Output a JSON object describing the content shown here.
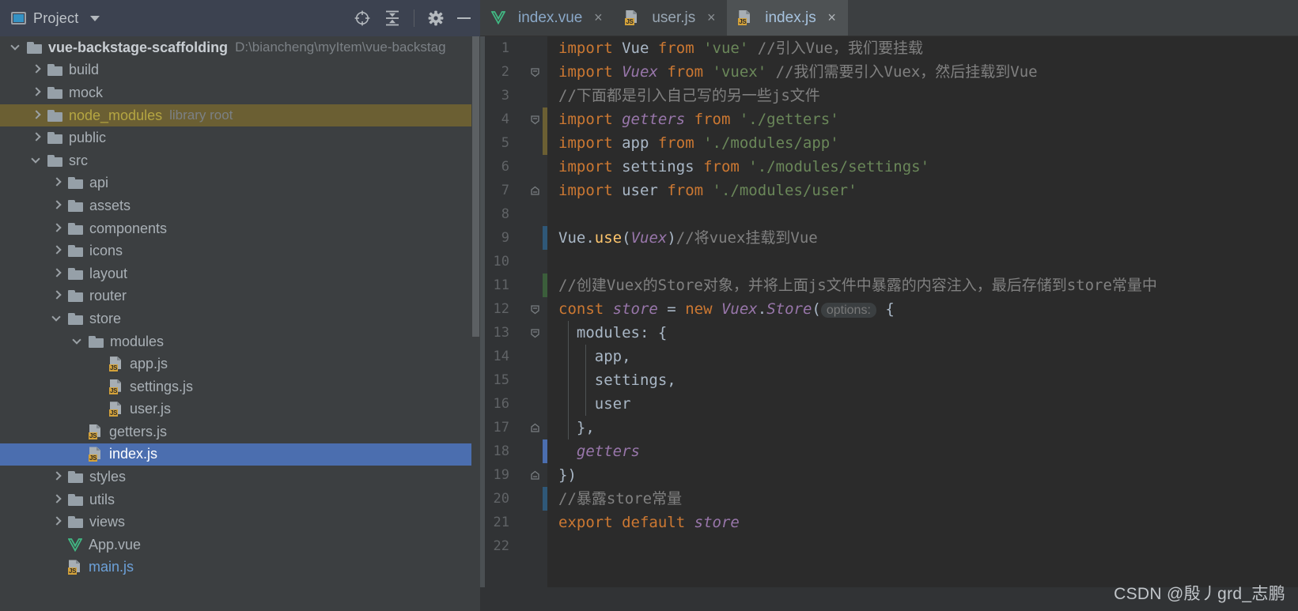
{
  "sidebar": {
    "title": "Project",
    "icons": [
      "project-window-icon",
      "chevron-down-icon",
      "locate-target-icon",
      "collapse-all-icon",
      "settings-gear-icon",
      "minimize-icon"
    ],
    "scrollbar": "vertical-scrollbar",
    "tree": [
      {
        "label": "vue-backstage-scaffolding",
        "sub": "D:\\biancheng\\myItem\\vue-backstag",
        "depth": 0,
        "type": "folder",
        "state": "open",
        "style": "root"
      },
      {
        "label": "build",
        "sub": "",
        "depth": 1,
        "type": "folder",
        "state": "closed",
        "style": "normal"
      },
      {
        "label": "mock",
        "sub": "",
        "depth": 1,
        "type": "folder",
        "state": "closed",
        "style": "normal"
      },
      {
        "label": "node_modules",
        "sub": "library root",
        "depth": 1,
        "type": "folder",
        "state": "closed",
        "style": "yellowed",
        "row": "highlight"
      },
      {
        "label": "public",
        "sub": "",
        "depth": 1,
        "type": "folder",
        "state": "closed",
        "style": "normal"
      },
      {
        "label": "src",
        "sub": "",
        "depth": 1,
        "type": "folder",
        "state": "open",
        "style": "normal"
      },
      {
        "label": "api",
        "sub": "",
        "depth": 2,
        "type": "folder",
        "state": "closed",
        "style": "normal"
      },
      {
        "label": "assets",
        "sub": "",
        "depth": 2,
        "type": "folder",
        "state": "closed",
        "style": "normal"
      },
      {
        "label": "components",
        "sub": "",
        "depth": 2,
        "type": "folder",
        "state": "closed",
        "style": "normal"
      },
      {
        "label": "icons",
        "sub": "",
        "depth": 2,
        "type": "folder",
        "state": "closed",
        "style": "normal"
      },
      {
        "label": "layout",
        "sub": "",
        "depth": 2,
        "type": "folder",
        "state": "closed",
        "style": "normal"
      },
      {
        "label": "router",
        "sub": "",
        "depth": 2,
        "type": "folder",
        "state": "closed",
        "style": "normal"
      },
      {
        "label": "store",
        "sub": "",
        "depth": 2,
        "type": "folder",
        "state": "open",
        "style": "normal"
      },
      {
        "label": "modules",
        "sub": "",
        "depth": 3,
        "type": "folder",
        "state": "open",
        "style": "normal"
      },
      {
        "label": "app.js",
        "sub": "",
        "depth": 4,
        "type": "js",
        "state": "leaf",
        "style": "normal"
      },
      {
        "label": "settings.js",
        "sub": "",
        "depth": 4,
        "type": "js",
        "state": "leaf",
        "style": "normal"
      },
      {
        "label": "user.js",
        "sub": "",
        "depth": 4,
        "type": "js",
        "state": "leaf",
        "style": "normal"
      },
      {
        "label": "getters.js",
        "sub": "",
        "depth": 3,
        "type": "js",
        "state": "leaf",
        "style": "normal"
      },
      {
        "label": "index.js",
        "sub": "",
        "depth": 3,
        "type": "js",
        "state": "leaf",
        "style": "normal",
        "row": "selected"
      },
      {
        "label": "styles",
        "sub": "",
        "depth": 2,
        "type": "folder",
        "state": "closed",
        "style": "normal"
      },
      {
        "label": "utils",
        "sub": "",
        "depth": 2,
        "type": "folder",
        "state": "closed",
        "style": "normal"
      },
      {
        "label": "views",
        "sub": "",
        "depth": 2,
        "type": "folder",
        "state": "closed",
        "style": "normal"
      },
      {
        "label": "App.vue",
        "sub": "",
        "depth": 2,
        "type": "vue",
        "state": "leaf",
        "style": "normal"
      },
      {
        "label": "main.js",
        "sub": "",
        "depth": 2,
        "type": "js",
        "state": "leaf",
        "style": "bluefile"
      }
    ]
  },
  "editor": {
    "tabs": [
      {
        "label": "index.vue",
        "icon": "vue-file-icon",
        "active": false,
        "close": "×"
      },
      {
        "label": "user.js",
        "icon": "js-file-icon",
        "active": false,
        "close": "×"
      },
      {
        "label": "index.js",
        "icon": "js-file-icon",
        "active": true,
        "close": "×"
      }
    ],
    "line_numbers": [
      "1",
      "2",
      "3",
      "4",
      "5",
      "6",
      "7",
      "8",
      "9",
      "10",
      "11",
      "12",
      "13",
      "14",
      "15",
      "16",
      "17",
      "18",
      "19",
      "20",
      "21",
      "22"
    ],
    "code_lines": [
      {
        "n": 1,
        "tokens": [
          {
            "t": "import",
            "c": "kw"
          },
          {
            "t": " ",
            "c": "punct"
          },
          {
            "t": "Vue",
            "c": "cls"
          },
          {
            "t": " ",
            "c": "punct"
          },
          {
            "t": "from",
            "c": "kw"
          },
          {
            "t": " ",
            "c": "punct"
          },
          {
            "t": "'vue'",
            "c": "str"
          },
          {
            "t": " ",
            "c": "punct"
          },
          {
            "t": "//引入Vue，我们要挂载",
            "c": "cmt"
          }
        ]
      },
      {
        "n": 2,
        "tokens": [
          {
            "t": "import",
            "c": "kw"
          },
          {
            "t": " ",
            "c": "punct"
          },
          {
            "t": "Vuex",
            "c": "glob"
          },
          {
            "t": " ",
            "c": "punct"
          },
          {
            "t": "from",
            "c": "kw"
          },
          {
            "t": " ",
            "c": "punct"
          },
          {
            "t": "'vuex'",
            "c": "str"
          },
          {
            "t": " ",
            "c": "punct"
          },
          {
            "t": "//我们需要引入Vuex，然后挂载到Vue",
            "c": "cmt"
          }
        ]
      },
      {
        "n": 3,
        "tokens": [
          {
            "t": "//下面都是引入自己写的另一些js文件",
            "c": "cmt"
          }
        ]
      },
      {
        "n": 4,
        "tokens": [
          {
            "t": "import",
            "c": "kw"
          },
          {
            "t": " ",
            "c": "punct"
          },
          {
            "t": "getters",
            "c": "glob"
          },
          {
            "t": " ",
            "c": "punct"
          },
          {
            "t": "from",
            "c": "kw"
          },
          {
            "t": " ",
            "c": "punct"
          },
          {
            "t": "'./getters'",
            "c": "str"
          }
        ]
      },
      {
        "n": 5,
        "tokens": [
          {
            "t": "import",
            "c": "kw"
          },
          {
            "t": " ",
            "c": "punct"
          },
          {
            "t": "app",
            "c": "cls"
          },
          {
            "t": " ",
            "c": "punct"
          },
          {
            "t": "from",
            "c": "kw"
          },
          {
            "t": " ",
            "c": "punct"
          },
          {
            "t": "'./modules/app'",
            "c": "str"
          }
        ]
      },
      {
        "n": 6,
        "tokens": [
          {
            "t": "import",
            "c": "kw"
          },
          {
            "t": " ",
            "c": "punct"
          },
          {
            "t": "settings",
            "c": "cls"
          },
          {
            "t": " ",
            "c": "punct"
          },
          {
            "t": "from",
            "c": "kw"
          },
          {
            "t": " ",
            "c": "punct"
          },
          {
            "t": "'./modules/settings'",
            "c": "str"
          }
        ]
      },
      {
        "n": 7,
        "tokens": [
          {
            "t": "import",
            "c": "kw"
          },
          {
            "t": " ",
            "c": "punct"
          },
          {
            "t": "user",
            "c": "cls"
          },
          {
            "t": " ",
            "c": "punct"
          },
          {
            "t": "from",
            "c": "kw"
          },
          {
            "t": " ",
            "c": "punct"
          },
          {
            "t": "'./modules/user'",
            "c": "str"
          }
        ]
      },
      {
        "n": 8,
        "tokens": []
      },
      {
        "n": 9,
        "tokens": [
          {
            "t": "Vue",
            "c": "cls"
          },
          {
            "t": ".",
            "c": "punct"
          },
          {
            "t": "use",
            "c": "fn"
          },
          {
            "t": "(",
            "c": "punct"
          },
          {
            "t": "Vuex",
            "c": "glob"
          },
          {
            "t": ")",
            "c": "punct"
          },
          {
            "t": "//将vuex挂载到Vue",
            "c": "cmt"
          }
        ]
      },
      {
        "n": 10,
        "tokens": []
      },
      {
        "n": 11,
        "tokens": [
          {
            "t": "//创建Vuex的Store对象，并将上面js文件中暴露的内容注入，最后存储到store常量中",
            "c": "cmt"
          }
        ]
      },
      {
        "n": 12,
        "tokens": [
          {
            "t": "const",
            "c": "kw"
          },
          {
            "t": " ",
            "c": "punct"
          },
          {
            "t": "store",
            "c": "glob"
          },
          {
            "t": " = ",
            "c": "punct"
          },
          {
            "t": "new",
            "c": "kw"
          },
          {
            "t": " ",
            "c": "punct"
          },
          {
            "t": "Vuex",
            "c": "glob"
          },
          {
            "t": ".",
            "c": "punct"
          },
          {
            "t": "Store",
            "c": "glob"
          },
          {
            "t": "(",
            "c": "punct"
          },
          {
            "t": "options:",
            "c": "hint"
          },
          {
            "t": " {",
            "c": "punct"
          }
        ]
      },
      {
        "n": 13,
        "tokens": [
          {
            "t": "  modules: {",
            "c": "punct"
          }
        ]
      },
      {
        "n": 14,
        "tokens": [
          {
            "t": "    app,",
            "c": "punct"
          }
        ]
      },
      {
        "n": 15,
        "tokens": [
          {
            "t": "    settings,",
            "c": "punct"
          }
        ]
      },
      {
        "n": 16,
        "tokens": [
          {
            "t": "    user",
            "c": "punct"
          }
        ]
      },
      {
        "n": 17,
        "tokens": [
          {
            "t": "  },",
            "c": "punct"
          }
        ]
      },
      {
        "n": 18,
        "tokens": [
          {
            "t": "  ",
            "c": "punct"
          },
          {
            "t": "getters",
            "c": "glob"
          }
        ]
      },
      {
        "n": 19,
        "tokens": [
          {
            "t": "})",
            "c": "punct"
          }
        ]
      },
      {
        "n": 20,
        "tokens": [
          {
            "t": "//暴露store常量",
            "c": "cmt"
          }
        ]
      },
      {
        "n": 21,
        "tokens": [
          {
            "t": "export",
            "c": "kw"
          },
          {
            "t": " ",
            "c": "punct"
          },
          {
            "t": "default",
            "c": "kw"
          },
          {
            "t": " ",
            "c": "punct"
          },
          {
            "t": "store",
            "c": "glob"
          }
        ]
      },
      {
        "n": 22,
        "tokens": []
      }
    ],
    "gutter_markers": [
      {
        "line": 4,
        "color": "#6b5f33"
      },
      {
        "line": 5,
        "color": "#6b5f33"
      },
      {
        "line": 9,
        "color": "#2f5878"
      },
      {
        "line": 11,
        "color": "#3b5e3b"
      },
      {
        "line": 18,
        "color": "#4b6eaf"
      },
      {
        "line": 20,
        "color": "#2f5878"
      }
    ],
    "fold_icons": [
      2,
      4,
      7,
      12,
      13,
      17,
      19
    ]
  },
  "watermark": "CSDN @殷丿grd_志鹏",
  "colors": {
    "editor_bg": "#2b2b2b",
    "sidebar_bg": "#3c3f41",
    "header_bg": "#3c4250",
    "selection_blue": "#4b6eaf",
    "highlight_olive": "#6b5f33",
    "keyword_orange": "#cc7832",
    "string_green": "#6a8759",
    "global_purple": "#9876aa",
    "comment_grey": "#808080",
    "js_badge": "#d4a23a",
    "vue_green": "#41b883"
  }
}
